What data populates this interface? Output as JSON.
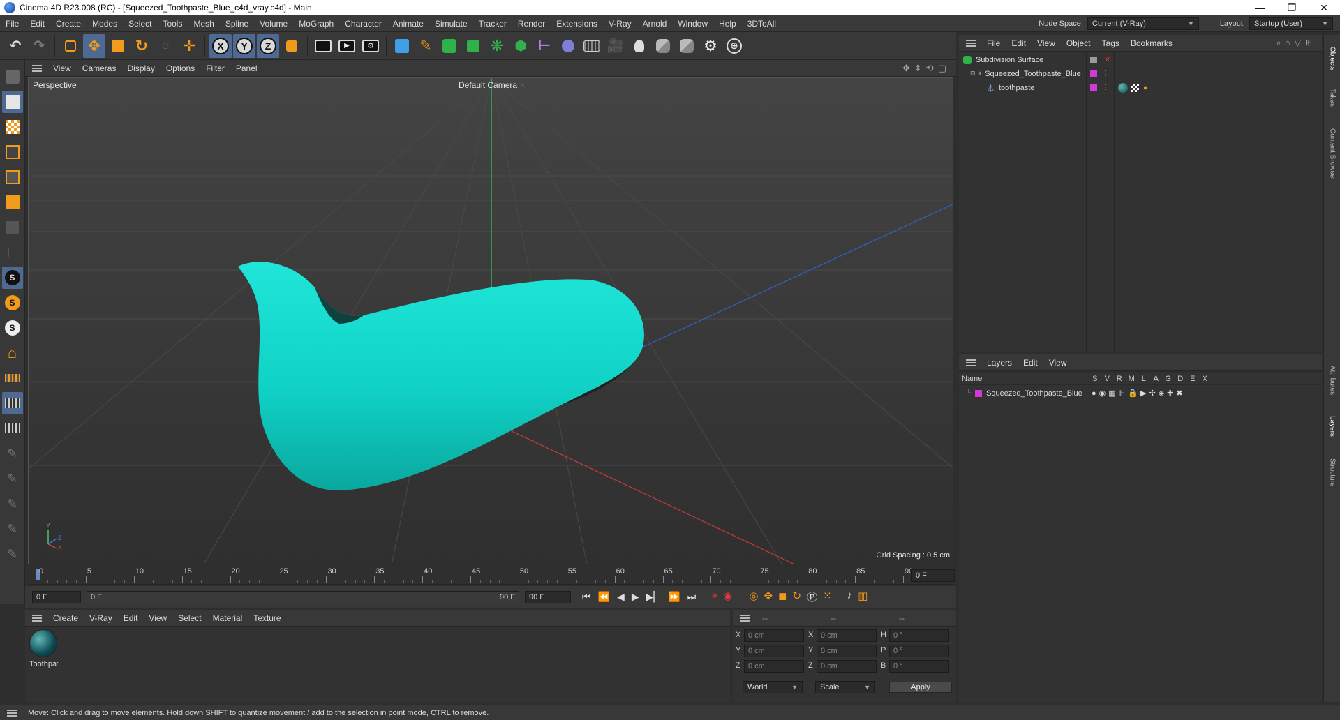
{
  "window": {
    "title": "Cinema 4D R23.008 (RC) - [Squeezed_Toothpaste_Blue_c4d_vray.c4d] - Main",
    "minimize": "—",
    "maximize": "❐",
    "close": "✕"
  },
  "menubar": {
    "items": [
      "File",
      "Edit",
      "Create",
      "Modes",
      "Select",
      "Tools",
      "Mesh",
      "Spline",
      "Volume",
      "MoGraph",
      "Character",
      "Animate",
      "Simulate",
      "Tracker",
      "Render",
      "Extensions",
      "V-Ray",
      "Arnold",
      "Window",
      "Help",
      "3DToAll"
    ],
    "node_space_label": "Node Space:",
    "node_space_value": "Current (V-Ray)",
    "layout_label": "Layout:",
    "layout_value": "Startup (User)"
  },
  "viewport": {
    "menu": [
      "View",
      "Cameras",
      "Display",
      "Options",
      "Filter",
      "Panel"
    ],
    "view_name": "Perspective",
    "camera_name": "Default Camera",
    "grid_spacing": "Grid Spacing : 0.5 cm",
    "axis_x": "X",
    "axis_y": "Y",
    "axis_z": "Z",
    "object_color": "#14d6c9"
  },
  "timeline": {
    "ticks": [
      "0",
      "5",
      "10",
      "15",
      "20",
      "25",
      "30",
      "35",
      "40",
      "45",
      "50",
      "55",
      "60",
      "65",
      "70",
      "75",
      "80",
      "85",
      "90"
    ],
    "current_frame": "0 F"
  },
  "transport": {
    "start_frame": "0 F",
    "range_start": "0 F",
    "range_end": "90 F",
    "end_frame": "90 F"
  },
  "material_manager": {
    "menu": [
      "Create",
      "V-Ray",
      "Edit",
      "View",
      "Select",
      "Material",
      "Texture"
    ],
    "materials": [
      {
        "name": "Toothpa:"
      }
    ]
  },
  "coordinates": {
    "header": [
      "--",
      "--",
      "--"
    ],
    "rows": [
      {
        "a": "X",
        "av": "0 cm",
        "b": "X",
        "bv": "0 cm",
        "c": "H",
        "cv": "0 °"
      },
      {
        "a": "Y",
        "av": "0 cm",
        "b": "Y",
        "bv": "0 cm",
        "c": "P",
        "cv": "0 °"
      },
      {
        "a": "Z",
        "av": "0 cm",
        "b": "Z",
        "bv": "0 cm",
        "c": "B",
        "cv": "0 °"
      }
    ],
    "space": "World",
    "mode": "Scale",
    "apply": "Apply"
  },
  "object_manager": {
    "menu": [
      "File",
      "Edit",
      "View",
      "Object",
      "Tags",
      "Bookmarks"
    ],
    "objects": [
      {
        "name": "Subdivision Surface"
      },
      {
        "name": "Squeezed_Toothpaste_Blue"
      },
      {
        "name": "toothpaste"
      }
    ]
  },
  "layer_manager": {
    "menu": [
      "Layers",
      "Edit",
      "View"
    ],
    "columns": [
      "Name",
      "S",
      "V",
      "R",
      "M",
      "L",
      "A",
      "G",
      "D",
      "E",
      "X"
    ],
    "layers": [
      {
        "name": "Squeezed_Toothpaste_Blue"
      }
    ]
  },
  "side_tabs": [
    "Objects",
    "Takes",
    "Content Browser",
    "Attributes",
    "Layers",
    "Structure"
  ],
  "status": {
    "message": "Move: Click and drag to move elements. Hold down SHIFT to quantize movement / add to the selection in point mode, CTRL to remove."
  }
}
